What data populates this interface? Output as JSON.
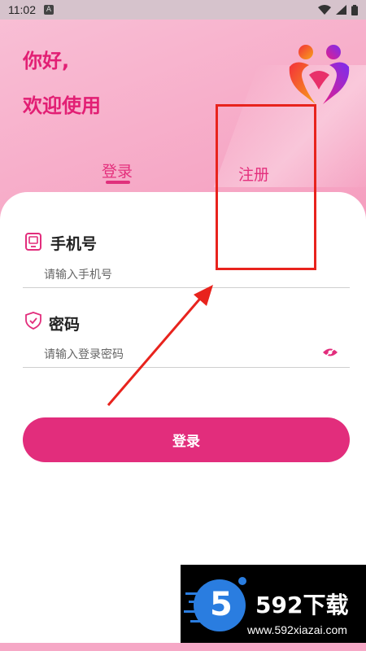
{
  "status_bar": {
    "time": "11:02",
    "notification_badge": "A",
    "icons": [
      "wifi-icon",
      "signal-icon",
      "battery-icon"
    ]
  },
  "greeting": {
    "line1": "你好,",
    "line2": "欢迎使用"
  },
  "tabs": [
    {
      "label": "登录",
      "active": true
    },
    {
      "label": "注册",
      "active": false
    }
  ],
  "phone_field": {
    "title": "手机号",
    "placeholder": "请输入手机号",
    "value": ""
  },
  "password_field": {
    "title": "密码",
    "placeholder": "请输入登录密码",
    "value": ""
  },
  "login_button": {
    "label": "登录"
  },
  "watermark": {
    "number": "5",
    "brand": "592下载",
    "url": "www.592xiazai.com"
  },
  "colors": {
    "accent": "#e22d7c",
    "annotation": "#e8231d",
    "hero_bg": "#f59ebf"
  }
}
